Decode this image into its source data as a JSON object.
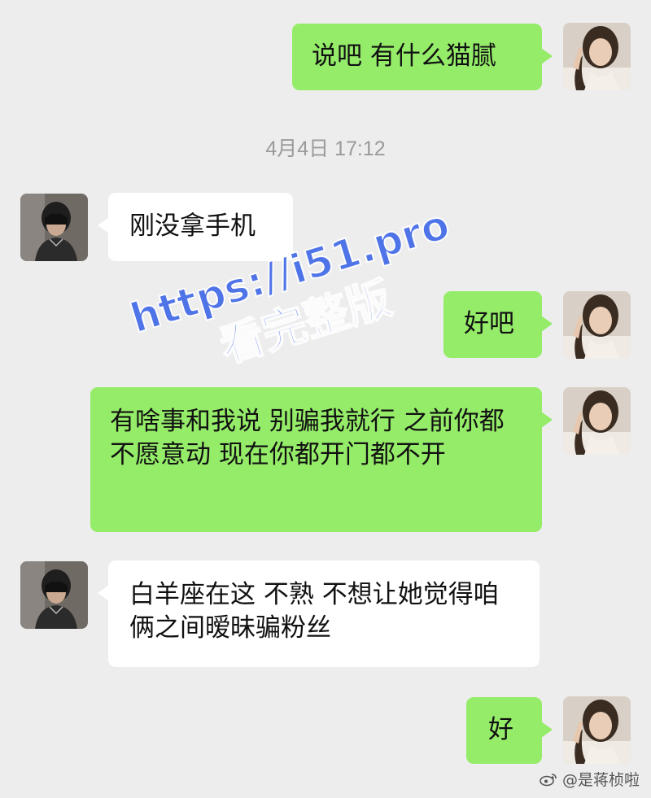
{
  "timestamp": "4月4日 17:12",
  "messages": [
    {
      "sender": "me",
      "text": "说吧 有什么猫腻"
    },
    {
      "sender": "other",
      "text": "刚没拿手机"
    },
    {
      "sender": "me",
      "text": "好吧"
    },
    {
      "sender": "me",
      "text": "有啥事和我说 别骗我就行 之前你都不愿意动 现在你都开门都不开"
    },
    {
      "sender": "other",
      "text": "白羊座在这 不熟 不想让她觉得咱俩之间暧昧骗粉丝"
    },
    {
      "sender": "me",
      "text": "好"
    }
  ],
  "watermark": {
    "url": "https://i51.pro",
    "subtitle": "看完整版"
  },
  "credit": {
    "icon": "weibo-icon",
    "text": "@是蒋桢啦"
  },
  "colors": {
    "background": "#ededed",
    "bubble_me": "#95ec69",
    "bubble_other": "#ffffff",
    "watermark": "#3a64e8"
  }
}
